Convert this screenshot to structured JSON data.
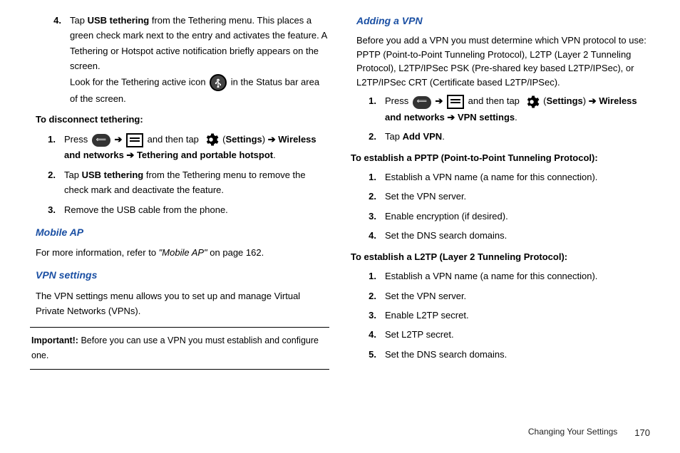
{
  "left": {
    "step4_num": "4.",
    "step4_line1_a": "Tap ",
    "step4_line1_bold": "USB tethering",
    "step4_line1_b": " from the Tethering menu. This places a green check mark next to the entry and activates the feature. A Tethering or Hotspot active notification briefly appears on the screen.",
    "step4_line2_a": "Look for the Tethering active icon ",
    "step4_line2_b": " in the Status bar area of the screen.",
    "disconnect_heading": "To disconnect tethering:",
    "d1_num": "1.",
    "d1_a": "Press ",
    "d1_b": " and then tap ",
    "d1_c": " (",
    "d1_settings": "Settings",
    "d1_d": ") ",
    "d1_wn": "Wireless and networks",
    "d1_tp": "Tethering and portable hotspot",
    "d2_num": "2.",
    "d2_a": "Tap ",
    "d2_bold": "USB tethering",
    "d2_b": " from the Tethering menu to remove the check mark and deactivate the feature.",
    "d3_num": "3.",
    "d3_a": "Remove the USB cable from the phone.",
    "mobile_ap_heading": "Mobile AP",
    "mobile_ap_body_a": "For more information, refer to ",
    "mobile_ap_italic": "\"Mobile AP\"",
    "mobile_ap_body_b": "  on page 162.",
    "vpn_settings_heading": "VPN settings",
    "vpn_settings_body": "The VPN settings menu allows you to set up and manage Virtual Private Networks (VPNs).",
    "important_label": "Important!:",
    "important_body": " Before you can use a VPN you must establish and configure one."
  },
  "right": {
    "adding_vpn_heading": "Adding a VPN",
    "adding_vpn_body": "Before you add a VPN you must determine which VPN protocol to use: PPTP (Point-to-Point Tunneling Protocol), L2TP (Layer 2 Tunneling Protocol), L2TP/IPSec PSK (Pre-shared key based L2TP/IPSec), or L2TP/IPSec CRT (Certificate based L2TP/IPSec).",
    "r1_num": "1.",
    "r1_a": "Press ",
    "r1_b": " and then tap ",
    "r1_c": " (",
    "r1_settings": "Settings",
    "r1_d": ") ",
    "r1_wn": "Wireless and networks",
    "r1_vpn": "VPN settings",
    "r2_num": "2.",
    "r2_a": "Tap ",
    "r2_bold": "Add VPN",
    "pptp_heading": "To establish a PPTP (Point-to-Point Tunneling Protocol):",
    "p1_num": "1.",
    "p1": "Establish a VPN name (a name for this connection).",
    "p2_num": "2.",
    "p2": "Set the VPN server.",
    "p3_num": "3.",
    "p3": "Enable encryption (if desired).",
    "p4_num": "4.",
    "p4": "Set the DNS search domains.",
    "l2tp_heading": "To establish a L2TP (Layer 2 Tunneling Protocol):",
    "l1_num": "1.",
    "l1": "Establish a VPN name (a name for this connection).",
    "l2_num": "2.",
    "l2": "Set the VPN server.",
    "l3_num": "3.",
    "l3": "Enable L2TP secret.",
    "l4_num": "4.",
    "l4": "Set L2TP secret.",
    "l5_num": "5.",
    "l5": "Set the DNS search domains."
  },
  "footer": {
    "section": "Changing Your Settings",
    "page": "170"
  },
  "arrow": "➔"
}
